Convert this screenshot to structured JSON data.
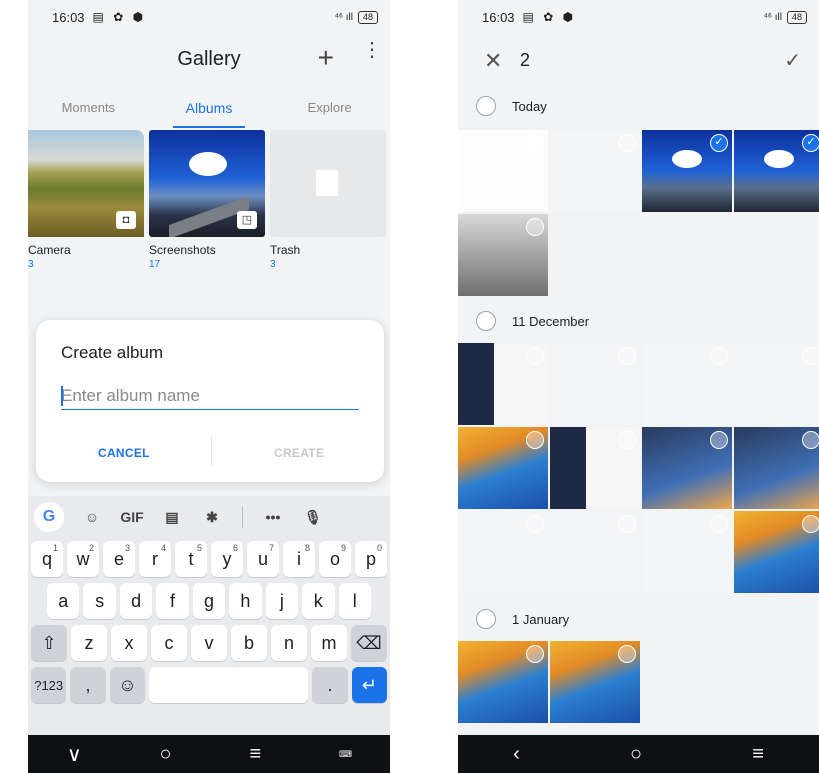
{
  "left": {
    "status": {
      "time": "16:03",
      "left_icons": "▤ ✿ ⬢",
      "right_icons": "⁴⁶ ıll ",
      "battery": "48"
    },
    "header": {
      "title": "Gallery",
      "add_icon": "+",
      "more_icon": "⋮"
    },
    "tabs": [
      {
        "label": "Moments",
        "active": false
      },
      {
        "label": "Albums",
        "active": true
      },
      {
        "label": "Explore",
        "active": false
      }
    ],
    "albums": [
      {
        "name": "Camera",
        "count": "3",
        "badge_icon": "camera-icon"
      },
      {
        "name": "Screenshots",
        "count": "17",
        "badge_icon": "screenshot-icon"
      },
      {
        "name": "Trash",
        "count": "3",
        "badge_icon": "trash-icon"
      }
    ],
    "dialog": {
      "title": "Create album",
      "placeholder": "Enter album name",
      "cancel": "CANCEL",
      "create": "CREATE"
    },
    "keyboard": {
      "toolbar": {
        "g": "G",
        "emoji": "☺",
        "gif": "GIF",
        "clipboard": "▤",
        "settings": "✱",
        "more": "•••",
        "mic": "🎙"
      },
      "row1": [
        [
          "q",
          "1"
        ],
        [
          "w",
          "2"
        ],
        [
          "e",
          "3"
        ],
        [
          "r",
          "4"
        ],
        [
          "t",
          "5"
        ],
        [
          "y",
          "6"
        ],
        [
          "u",
          "7"
        ],
        [
          "i",
          "8"
        ],
        [
          "o",
          "9"
        ],
        [
          "p",
          "0"
        ]
      ],
      "row2": [
        "a",
        "s",
        "d",
        "f",
        "g",
        "h",
        "j",
        "k",
        "l"
      ],
      "row3": [
        "z",
        "x",
        "c",
        "v",
        "b",
        "n",
        "m"
      ],
      "shift": "⇧",
      "backspace": "⌫",
      "sym": "?123",
      "comma": ",",
      "emoji": "☺",
      "period": ".",
      "enter": "↵"
    },
    "nav": {
      "back": "∨",
      "home": "○",
      "recents": "≡",
      "kb": "⌨"
    }
  },
  "right": {
    "status": {
      "time": "16:03",
      "left_icons": "▤ ✿ ⬢",
      "right_icons": "⁴⁶ ıll ",
      "battery": "48"
    },
    "header": {
      "close_icon": "✕",
      "selected_count": "2",
      "confirm_icon": "✓"
    },
    "sections": [
      {
        "label": "Today"
      },
      {
        "label": "11 December"
      },
      {
        "label": "1 January"
      }
    ],
    "nav": {
      "back": "‹",
      "home": "○",
      "recents": "≡"
    }
  },
  "colors": {
    "accent": "#1a73e8",
    "navbar": "#0f1013",
    "background": "#f1f3f5"
  }
}
